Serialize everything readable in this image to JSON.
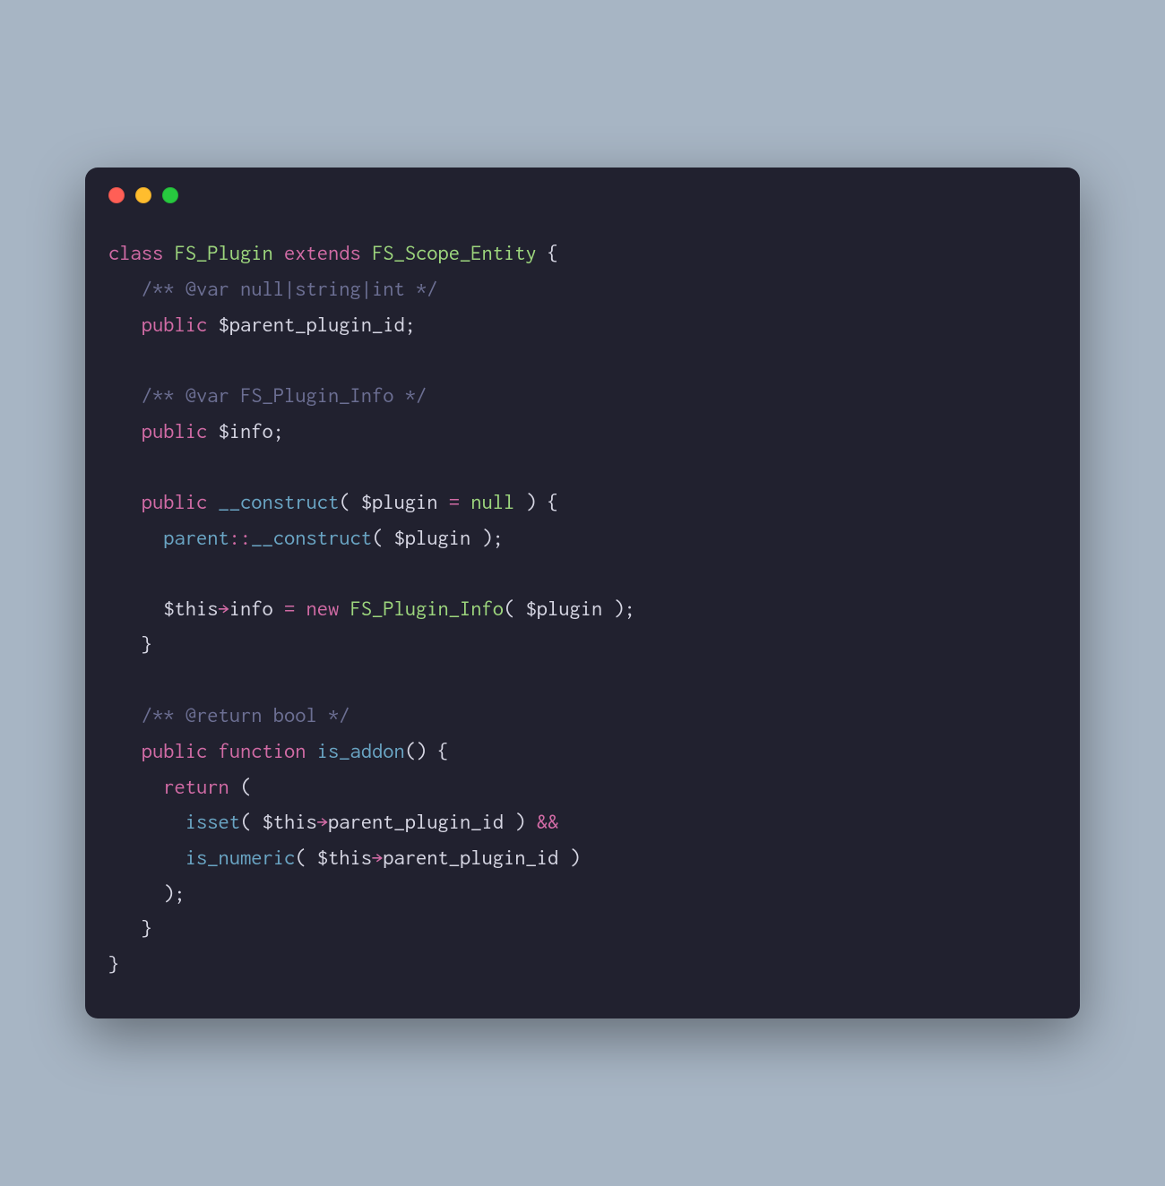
{
  "window": {
    "traffic_lights": [
      "red",
      "yellow",
      "green"
    ]
  },
  "code": {
    "line1": {
      "kw1": "class",
      "cls1": "FS_Plugin",
      "kw2": "extends",
      "cls2": "FS_Scope_Entity",
      "brace": " {"
    },
    "line2": {
      "indent": "   ",
      "cmt": "/** @var null|string|int */"
    },
    "line3": {
      "indent": "   ",
      "kw": "public",
      "var": " $parent_plugin_id;"
    },
    "line4": {
      "blank": ""
    },
    "line5": {
      "indent": "   ",
      "cmt": "/** @var FS_Plugin_Info */"
    },
    "line6": {
      "indent": "   ",
      "kw": "public",
      "var": " $info;"
    },
    "line7": {
      "blank": ""
    },
    "line8": {
      "indent": "   ",
      "kw": "public",
      "sp": " ",
      "fn": "__construct",
      "args_open": "( $plugin ",
      "op": "=",
      "nul": " null",
      "args_close": " ) {"
    },
    "line9": {
      "indent": "     ",
      "parent": "parent",
      "scope": "::",
      "fn": "__construct",
      "args": "( $plugin );"
    },
    "line10": {
      "blank": ""
    },
    "line11": {
      "indent": "     ",
      "this": "$this",
      "arrow": "→",
      "prop": "info ",
      "op": "=",
      "new": " new",
      "cls": " FS_Plugin_Info",
      "args": "( $plugin );"
    },
    "line12": {
      "indent": "   ",
      "brace": "}"
    },
    "line13": {
      "blank": ""
    },
    "line14": {
      "indent": "   ",
      "cmt": "/** @return bool */"
    },
    "line15": {
      "indent": "   ",
      "kw1": "public",
      "sp": " ",
      "kw2": "function",
      "sp2": " ",
      "fn": "is_addon",
      "rest": "() {"
    },
    "line16": {
      "indent": "     ",
      "kw": "return",
      "rest": " ("
    },
    "line17": {
      "indent": "       ",
      "fn": "isset",
      "open": "( ",
      "this": "$this",
      "arrow": "→",
      "prop": "parent_plugin_id",
      "close": " ) ",
      "and": "&&"
    },
    "line18": {
      "indent": "       ",
      "fn": "is_numeric",
      "open": "( ",
      "this": "$this",
      "arrow": "→",
      "prop": "parent_plugin_id",
      "close": " )"
    },
    "line19": {
      "indent": "     ",
      "rest": ");"
    },
    "line20": {
      "indent": "   ",
      "brace": "}"
    },
    "line21": {
      "brace": "}"
    }
  }
}
